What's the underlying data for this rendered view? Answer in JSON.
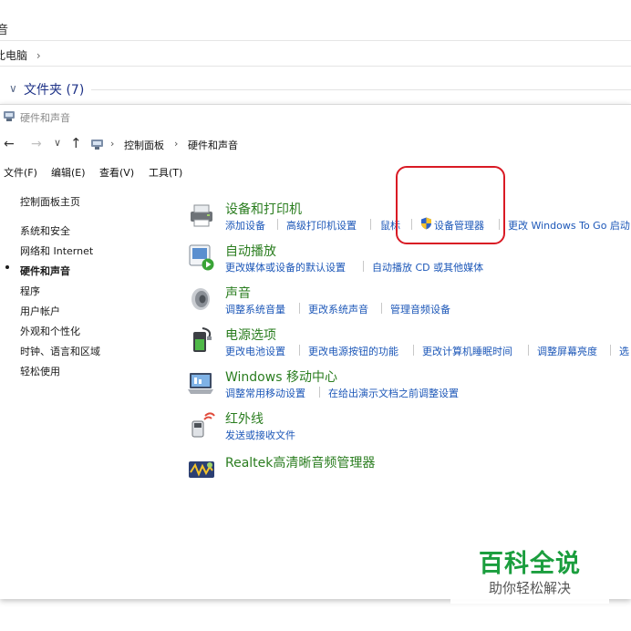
{
  "background_window": {
    "title": "音",
    "address": "此电脑",
    "address_chevron": "›",
    "folder_chevron": "∨",
    "folder_label": "文件夹 (7)"
  },
  "window": {
    "title": "硬件和声音"
  },
  "nav": {
    "back": "←",
    "forward": "→",
    "recent": "∨",
    "up": "↑",
    "crumb_sep": "›",
    "breadcrumb": [
      "控制面板",
      "硬件和声音"
    ]
  },
  "menu": [
    "文件(F)",
    "编辑(E)",
    "查看(V)",
    "工具(T)"
  ],
  "sidebar": {
    "items": [
      {
        "label": "控制面板主页"
      },
      {
        "label": "系统和安全"
      },
      {
        "label": "网络和 Internet"
      },
      {
        "label": "硬件和声音",
        "active": true
      },
      {
        "label": "程序"
      },
      {
        "label": "用户帐户"
      },
      {
        "label": "外观和个性化"
      },
      {
        "label": "时钟、语言和区域"
      },
      {
        "label": "轻松使用"
      }
    ]
  },
  "categories": [
    {
      "title": "设备和打印机",
      "icon": "printer-icon",
      "links": [
        "添加设备",
        "高级打印机设置",
        "鼠标",
        "设备管理器",
        "更改 Windows To Go 启动"
      ]
    },
    {
      "title": "自动播放",
      "icon": "autoplay-icon",
      "links": [
        "更改媒体或设备的默认设置",
        "自动播放 CD 或其他媒体"
      ]
    },
    {
      "title": "声音",
      "icon": "speaker-icon",
      "links": [
        "调整系统音量",
        "更改系统声音",
        "管理音频设备"
      ]
    },
    {
      "title": "电源选项",
      "icon": "battery-icon",
      "links": [
        "更改电池设置",
        "更改电源按钮的功能",
        "更改计算机睡眠时间",
        "调整屏幕亮度",
        "选"
      ]
    },
    {
      "title": "Windows 移动中心",
      "icon": "mobility-center-icon",
      "links": [
        "调整常用移动设置",
        "在给出演示文档之前调整设置"
      ]
    },
    {
      "title": "红外线",
      "icon": "infrared-icon",
      "links": [
        "发送或接收文件"
      ]
    },
    {
      "title": "Realtek高清晰音频管理器",
      "icon": "realtek-audio-icon",
      "links": []
    }
  ],
  "watermark": {
    "title": "百科全说",
    "subtitle": "助你轻松解决"
  },
  "colors": {
    "category_title": "#2a7d1f",
    "link": "#1c57b8",
    "annotation": "#d91a24",
    "watermark": "#1b9e3e"
  }
}
